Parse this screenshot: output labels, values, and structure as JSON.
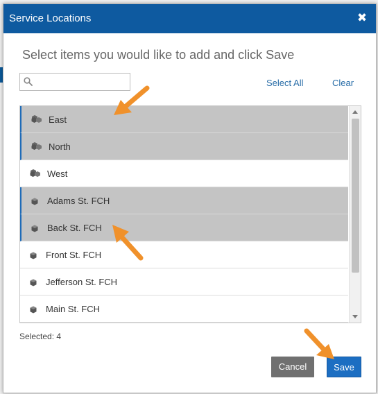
{
  "dialog": {
    "title": "Service Locations",
    "close_symbol": "✖",
    "instruction": "Select items you would like to add and click Save"
  },
  "search": {
    "value": "",
    "placeholder": ""
  },
  "links": {
    "select_all": "Select All",
    "clear": "Clear"
  },
  "items": [
    {
      "label": "East",
      "type": "group",
      "selected": true,
      "icon": "group-locations-icon"
    },
    {
      "label": "North",
      "type": "group",
      "selected": true,
      "icon": "group-locations-icon"
    },
    {
      "label": "West",
      "type": "group",
      "selected": false,
      "icon": "group-locations-icon"
    },
    {
      "label": "Adams St. FCH",
      "type": "site",
      "selected": true,
      "icon": "site-cube-icon"
    },
    {
      "label": "Back St. FCH",
      "type": "site",
      "selected": true,
      "icon": "site-cube-icon"
    },
    {
      "label": "Front St. FCH",
      "type": "site",
      "selected": false,
      "icon": "site-cube-icon"
    },
    {
      "label": "Jefferson St. FCH",
      "type": "site",
      "selected": false,
      "icon": "site-cube-icon"
    },
    {
      "label": "Main St. FCH",
      "type": "site",
      "selected": false,
      "icon": "site-cube-icon"
    }
  ],
  "footer": {
    "selected_text": "Selected: 4"
  },
  "buttons": {
    "cancel": "Cancel",
    "save": "Save"
  },
  "colors": {
    "header": "#0e5aa0",
    "selected_row": "#c4c4c4",
    "save_button": "#1c6ec2",
    "cancel_button": "#707070",
    "annotation_arrow": "#f0912b"
  }
}
